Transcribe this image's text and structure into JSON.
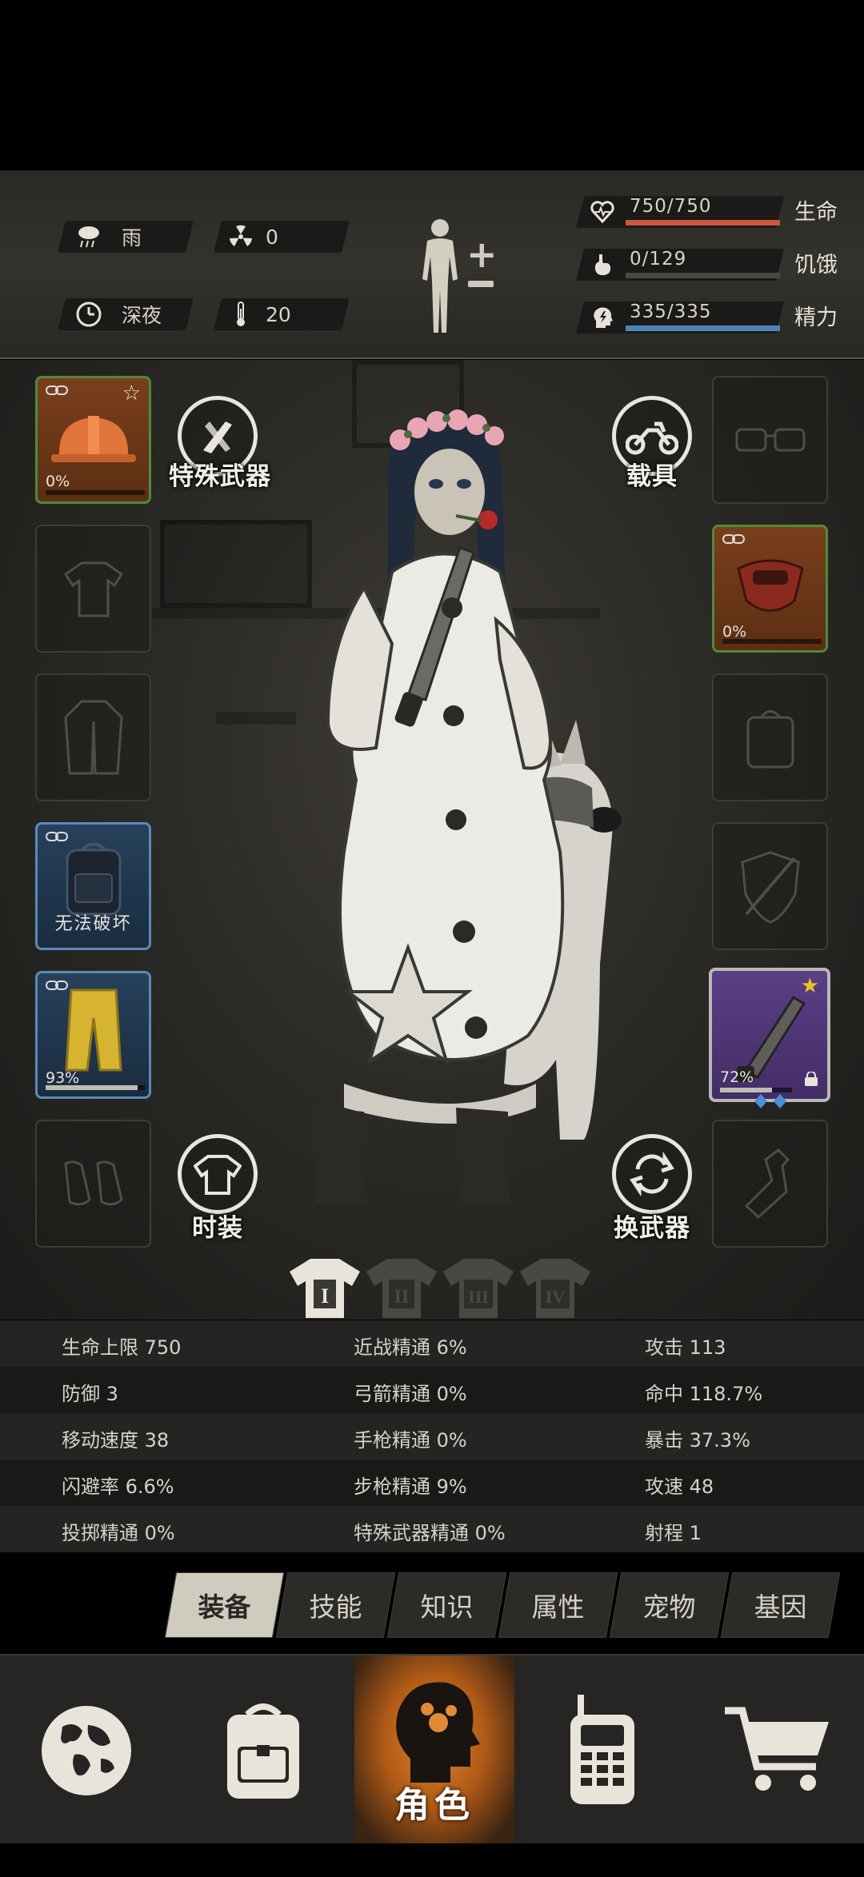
{
  "status": {
    "weather": "雨",
    "radiation": "0",
    "time_of_day": "深夜",
    "temperature": "20",
    "life": {
      "value": "750/750",
      "label": "生命",
      "fraction": 1.0,
      "color": "#c8553d"
    },
    "hunger": {
      "value": "0/129",
      "label": "饥饿",
      "fraction": 0.0,
      "color": "#8a8a82"
    },
    "energy": {
      "value": "335/335",
      "label": "精力",
      "fraction": 1.0,
      "color": "#4b86b8"
    }
  },
  "equipment": {
    "left": [
      {
        "slot": "helmet",
        "percent": "0%",
        "durability": 0.0,
        "icon": "hardhat-icon"
      },
      {
        "slot": "shirt",
        "icon": "shirt-icon"
      },
      {
        "slot": "coat",
        "icon": "coat-icon"
      },
      {
        "slot": "backpack",
        "status": "无法破坏",
        "icon": "backpack-icon"
      },
      {
        "slot": "pants",
        "percent": "93%",
        "durability": 0.93,
        "icon": "pants-icon"
      },
      {
        "slot": "shoes",
        "icon": "shoes-icon"
      }
    ],
    "right": [
      {
        "slot": "glasses",
        "icon": "glasses-icon"
      },
      {
        "slot": "mask",
        "percent": "0%",
        "durability": 0.0,
        "icon": "mask-icon"
      },
      {
        "slot": "bag",
        "icon": "bag-icon"
      },
      {
        "slot": "armor",
        "icon": "armor-icon"
      },
      {
        "slot": "weapon",
        "percent": "72%",
        "durability": 0.72,
        "icon": "machete-icon"
      },
      {
        "slot": "throwable",
        "icon": "bottle-icon"
      }
    ],
    "buttons": {
      "special_weapon": "特殊武器",
      "vehicle": "载具",
      "fashion": "时装",
      "switch_weapon": "换武器"
    },
    "outfit_tabs": [
      "I",
      "II",
      "III",
      "IV"
    ]
  },
  "stats": {
    "rows": [
      [
        "生命上限 750",
        "近战精通 6%",
        "攻击 113"
      ],
      [
        "防御 3",
        "弓箭精通 0%",
        "命中 118.7%"
      ],
      [
        "移动速度 38",
        "手枪精通 0%",
        "暴击 37.3%"
      ],
      [
        "闪避率 6.6%",
        "步枪精通 9%",
        "攻速 48"
      ],
      [
        "投掷精通 0%",
        "特殊武器精通 0%",
        "射程 1"
      ]
    ]
  },
  "tabs": [
    "装备",
    "技能",
    "知识",
    "属性",
    "宠物",
    "基因"
  ],
  "nav": {
    "items": [
      "world-map",
      "inventory",
      "character",
      "phone",
      "shop"
    ],
    "active_label": "角色"
  }
}
